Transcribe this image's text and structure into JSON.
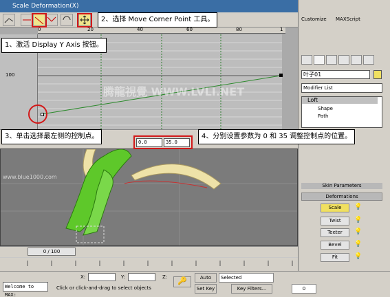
{
  "window": {
    "title": "Scale Deformation(X)"
  },
  "graph": {
    "ruler_ticks": [
      "0",
      "20",
      "40",
      "60",
      "80",
      "1"
    ],
    "y_label": "100"
  },
  "value_bar": {
    "field1": "0.0",
    "field2": "35.0"
  },
  "timeline": {
    "slider_label": "0 / 100"
  },
  "statusbar": {
    "welcome": "Welcome to MAX:",
    "prompt": "Click or click-and-drag to select objects",
    "x_label": "X:",
    "y_label": "Y:",
    "z_label": "Z:",
    "auto_key": "Auto Key",
    "selected": "Selected",
    "set_key": "Set Key",
    "key_filters": "Key Filters...",
    "frame": "0"
  },
  "panel": {
    "menu_customize": "Customize",
    "menu_maxscript": "MAXScript",
    "object_name": "叶子01",
    "modifier_list": "Modifier List",
    "stack": [
      "Loft",
      "Shape",
      "Path"
    ],
    "rollout_skin": "Skin Parameters",
    "rollout_deform": "Deformations",
    "deform_buttons": [
      "Scale",
      "Twist",
      "Teeter",
      "Bevel",
      "Fit"
    ]
  },
  "annotations": {
    "step1": "1、激活 Display Y Axis 按钮。",
    "step2": "2、选择 Move Corner Point 工具。",
    "step3": "3、单击选择最左侧的控制点。",
    "step4": "4、分别设置参数为 0 和 35 调整控制点的位置。",
    "watermark": "腾龍視覺 WWW.LVLI.NET",
    "site": "www.blue1000.com"
  },
  "colors": {
    "annotation_red": "#d21919",
    "active_button": "#f0e060",
    "leaf_green": "#5ec82a"
  }
}
